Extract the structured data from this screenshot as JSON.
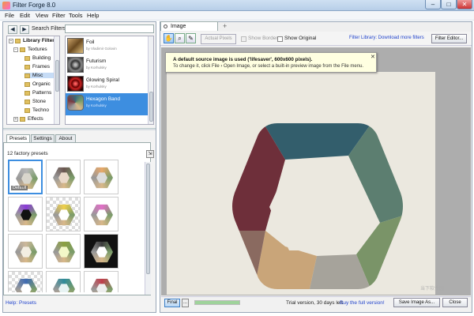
{
  "window": {
    "title": "Filter Forge 8.0",
    "min": "–",
    "max": "□",
    "close": "✕"
  },
  "menu": [
    "File",
    "Edit",
    "View",
    "Filter",
    "Tools",
    "Help"
  ],
  "library": {
    "back": "◀",
    "forward": "▶",
    "search_label": "Search Filters:",
    "search_value": "",
    "tree": [
      {
        "label": "Library Filters",
        "fold": "−",
        "bold": true
      },
      {
        "label": "Textures",
        "fold": "−"
      },
      {
        "label": "Building"
      },
      {
        "label": "Frames"
      },
      {
        "label": "Misc",
        "selected": true
      },
      {
        "label": "Organic"
      },
      {
        "label": "Patterns"
      },
      {
        "label": "Stone"
      },
      {
        "label": "Techno"
      },
      {
        "label": "Effects",
        "fold": "+"
      }
    ],
    "filters": [
      {
        "name": "Foil",
        "author": "by Vladimir Golovin"
      },
      {
        "name": "Futurism",
        "author": "by Korhulsky"
      },
      {
        "name": "Glowing Spiral",
        "author": "by Korhulsky"
      },
      {
        "name": "Hexagon Band",
        "author": "by Korhulsky",
        "selected": true
      }
    ]
  },
  "presets": {
    "tabs": [
      "Presets",
      "Settings",
      "About"
    ],
    "count_label": "12 factory presets",
    "button_icon": "⇲",
    "default_badge": "Default",
    "help_link": "Help: Presets",
    "colors": [
      [
        "#b7b7b7",
        "#d9d6cc"
      ],
      [
        "#6b5650",
        "#ead9c9"
      ],
      [
        "#e8a86a",
        "#dcdcdc"
      ],
      [
        "#8a3ad8",
        "#111111"
      ],
      [
        "#f0d04a",
        "#ffffff"
      ],
      [
        "#e26ec8",
        "#ffffff"
      ],
      [
        "#cdb89a",
        "#f3eee2"
      ],
      [
        "#8ca040",
        "#f3f8c8"
      ],
      [
        "#3a3a3a",
        "#ffffff"
      ],
      [
        "#3e6ab2",
        "#ffffff"
      ],
      [
        "#2e8b9a",
        "#e7f3f3"
      ],
      [
        "#c03c4a",
        "#eeeeee"
      ]
    ]
  },
  "image_tab": {
    "label": "Image",
    "plus": "+"
  },
  "toolbar": {
    "actual_pixels": "Actual Pixels",
    "show_border": "Show Border",
    "show_original": "Show Original",
    "library_link": "Filter Library: Download more filters",
    "editor": "Filter Editor..."
  },
  "tooltip": {
    "title": "A default source image is used ('lifesaver', 600x600 pixels).",
    "body": "To change it, click File › Open Image, or select a built-in preview image from the File menu.",
    "close": "✕"
  },
  "status": {
    "final": "Final",
    "dots": "...",
    "progress": 1.0,
    "trial": "Trial version, 30 days left.",
    "buy": "Buy the full version!",
    "save": "Save Image As...",
    "close": "Close"
  },
  "watermark": "当下软件园",
  "colors": {
    "accent": "#3d8ee0",
    "link": "#2244cc",
    "canvas_bg": "#ebe8df"
  }
}
